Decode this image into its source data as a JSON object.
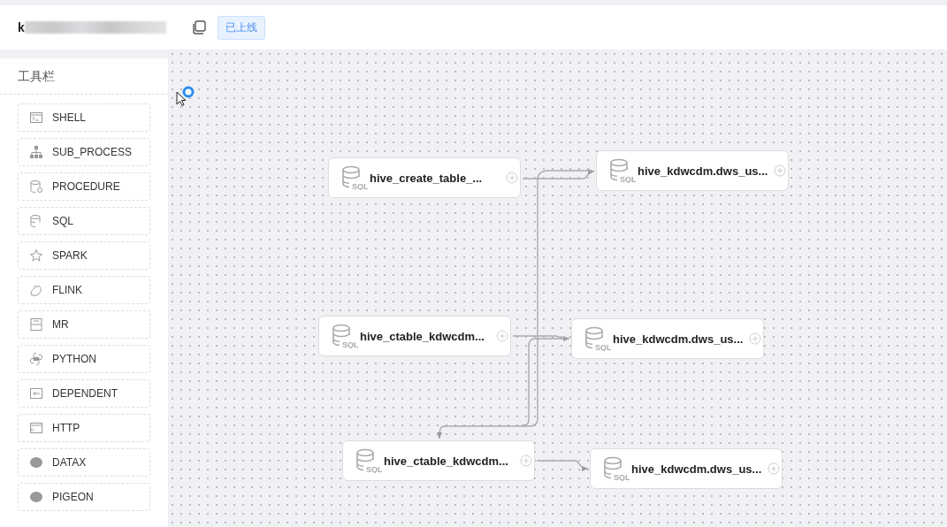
{
  "header": {
    "title": "k",
    "status_badge": "已上线"
  },
  "toolbar": {
    "title": "工具栏",
    "items": [
      {
        "label": "SHELL",
        "kind": "shell"
      },
      {
        "label": "SUB_PROCESS",
        "kind": "subprocess"
      },
      {
        "label": "PROCEDURE",
        "kind": "procedure"
      },
      {
        "label": "SQL",
        "kind": "sql"
      },
      {
        "label": "SPARK",
        "kind": "spark"
      },
      {
        "label": "FLINK",
        "kind": "flink"
      },
      {
        "label": "MR",
        "kind": "mr"
      },
      {
        "label": "PYTHON",
        "kind": "python"
      },
      {
        "label": "DEPENDENT",
        "kind": "dependent"
      },
      {
        "label": "HTTP",
        "kind": "http"
      },
      {
        "label": "DATAX",
        "kind": "datax"
      },
      {
        "label": "PIGEON",
        "kind": "pigeon"
      }
    ]
  },
  "canvas": {
    "nodes": [
      {
        "label": "hive_create_table_...",
        "kind": "sql",
        "icon_text": "SQL"
      },
      {
        "label": "hive_kdwcdm.dws_us...",
        "kind": "sql",
        "icon_text": "SQL"
      },
      {
        "label": "hive_ctable_kdwcdm...",
        "kind": "sql",
        "icon_text": "SQL"
      },
      {
        "label": "hive_kdwcdm.dws_us...",
        "kind": "sql",
        "icon_text": "SQL"
      },
      {
        "label": "hive_ctable_kdwcdm...",
        "kind": "sql",
        "icon_text": "SQL"
      },
      {
        "label": "hive_kdwcdm.dws_us...",
        "kind": "sql",
        "icon_text": "SQL"
      }
    ]
  }
}
